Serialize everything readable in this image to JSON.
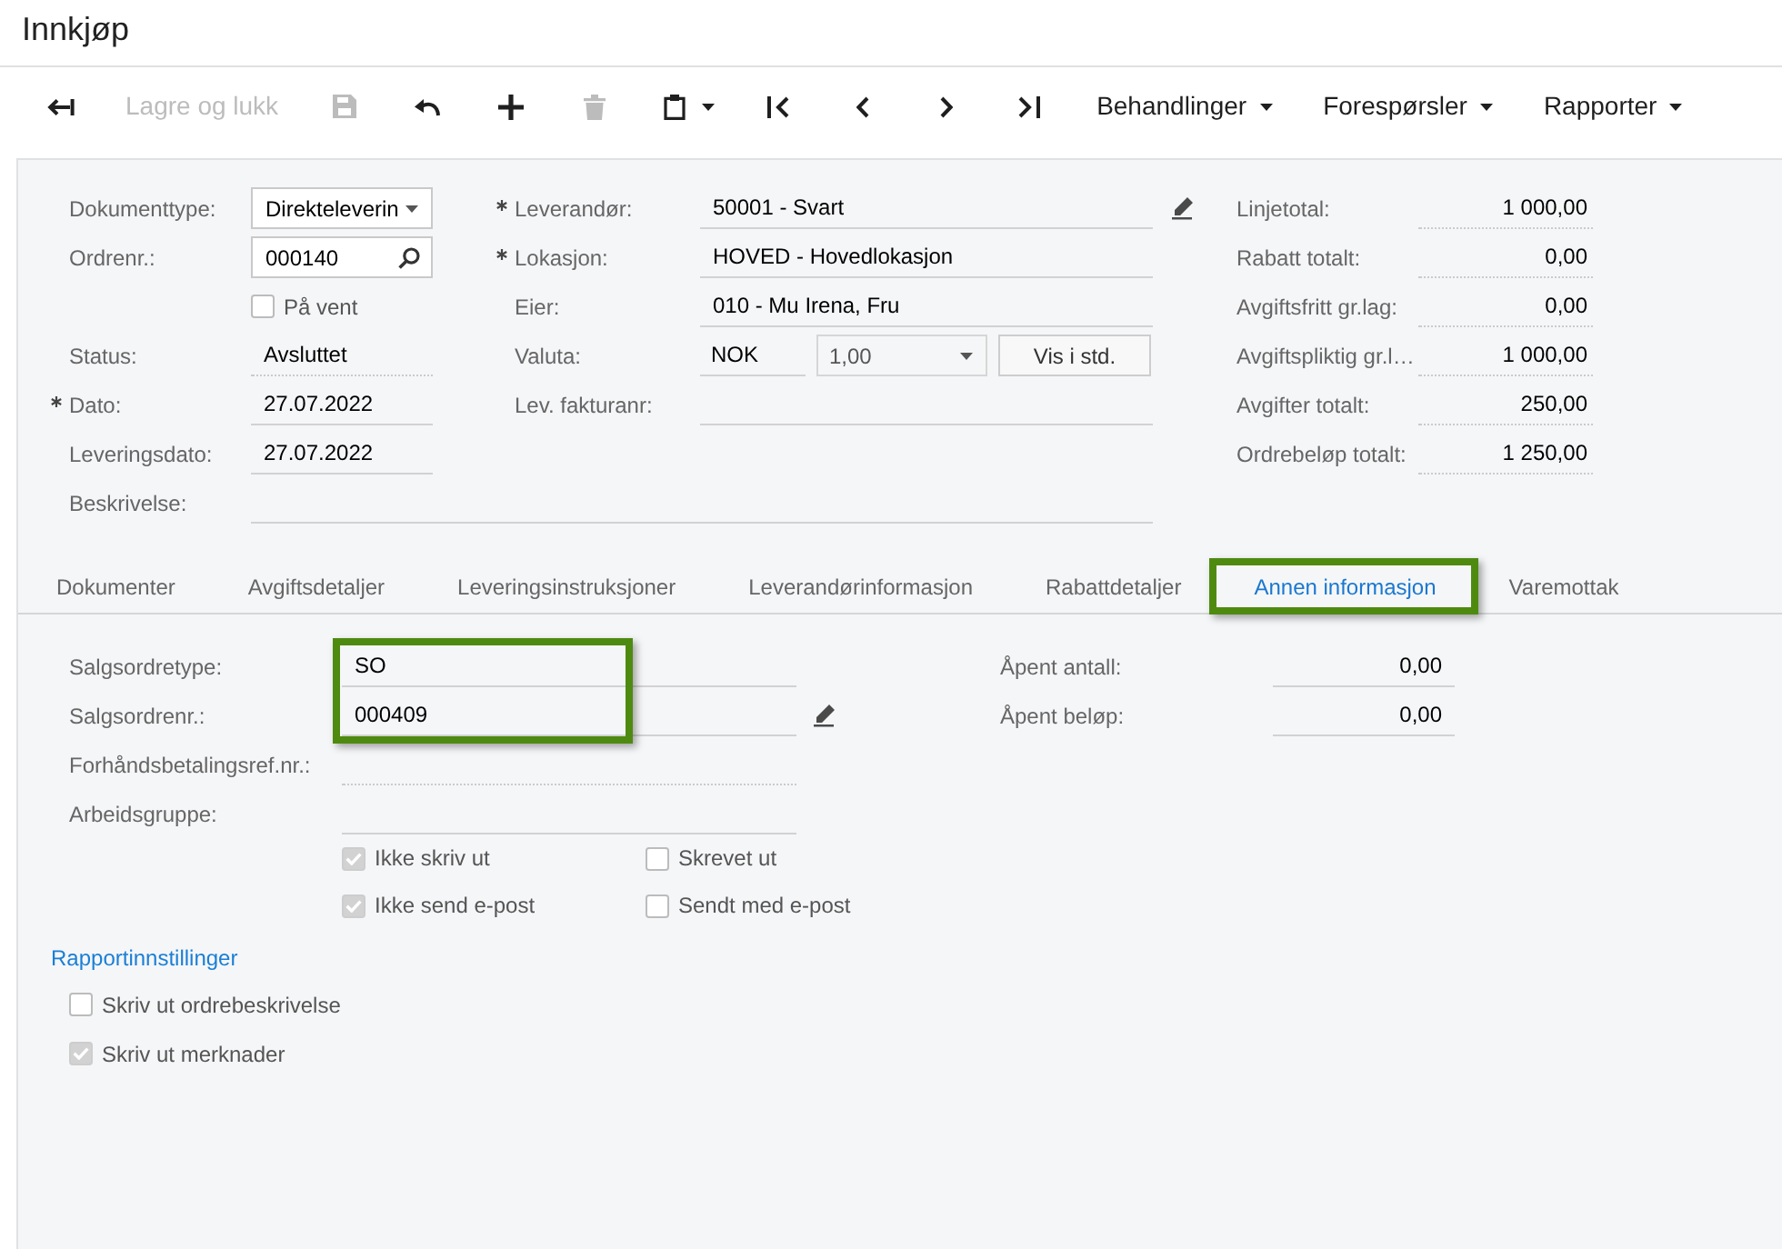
{
  "page_title": "Innkjøp",
  "toolbar": [
    {
      "kind": "back",
      "disabled": false,
      "dropdown": false
    },
    {
      "kind": "save_close",
      "label": "Lagre og lukk",
      "disabled": true,
      "dropdown": false
    },
    {
      "kind": "save",
      "disabled": true,
      "dropdown": false
    },
    {
      "kind": "undo",
      "disabled": false,
      "dropdown": false
    },
    {
      "kind": "add",
      "disabled": false,
      "dropdown": false
    },
    {
      "kind": "delete",
      "disabled": true,
      "dropdown": false
    },
    {
      "kind": "paste",
      "disabled": false,
      "dropdown": true
    },
    {
      "kind": "first",
      "disabled": false,
      "dropdown": false
    },
    {
      "kind": "previous",
      "disabled": false,
      "dropdown": false
    },
    {
      "kind": "next",
      "disabled": false,
      "dropdown": false
    },
    {
      "kind": "last",
      "disabled": false,
      "dropdown": false
    },
    {
      "kind": "menu",
      "label": "Behandlinger",
      "disabled": false,
      "dropdown": true
    },
    {
      "kind": "menu",
      "label": "Forespørsler",
      "disabled": false,
      "dropdown": true
    },
    {
      "kind": "menu",
      "label": "Rapporter",
      "disabled": false,
      "dropdown": true
    }
  ],
  "summary": {
    "left": [
      {
        "kind": "select",
        "label": "Dokumenttype:",
        "value": "Direkteleverin",
        "required": false
      },
      {
        "kind": "lookup",
        "label": "Ordrenr.:",
        "value": "000140",
        "required": false
      },
      {
        "kind": "checkbox",
        "label": "På vent",
        "checked": false,
        "required": false
      },
      {
        "kind": "readonly",
        "label": "Status:",
        "value": "Avsluttet",
        "required": false
      },
      {
        "kind": "input",
        "label": "Dato:",
        "value": "27.07.2022",
        "required": true
      },
      {
        "kind": "input",
        "label": "Leveringsdato:",
        "value": "27.07.2022",
        "required": false
      },
      {
        "kind": "wide_input",
        "label": "Beskrivelse:",
        "required": false
      }
    ],
    "middle": [
      {
        "kind": "input",
        "label": "Leverandør:",
        "value": "50001 - Svart",
        "required": true,
        "editable": true
      },
      {
        "kind": "input",
        "label": "Lokasjon:",
        "value": "HOVED - Hovedlokasjon",
        "required": true,
        "editable": false
      },
      {
        "kind": "input",
        "label": "Eier:",
        "value": "010 - Mu Irena, Fru",
        "required": false,
        "editable": false
      },
      {
        "kind": "currency",
        "label": "Valuta:",
        "value": "NOK",
        "rate": "1,00",
        "button": "Vis i std.",
        "required": false,
        "editable": false
      },
      {
        "kind": "input",
        "label": "Lev. fakturanr:",
        "required": false,
        "editable": false
      }
    ],
    "totals": [
      {
        "label": "Linjetotal:",
        "value": "1 000,00"
      },
      {
        "label": "Rabatt totalt:",
        "value": "0,00"
      },
      {
        "label": "Avgiftsfritt gr.lag:",
        "value": "0,00"
      },
      {
        "label": "Avgiftspliktig gr.l…",
        "value": "1 000,00"
      },
      {
        "label": "Avgifter totalt:",
        "value": "250,00"
      },
      {
        "label": "Ordrebeløp totalt:",
        "value": "1 250,00"
      }
    ]
  },
  "tabs": [
    {
      "label": "Dokumenter",
      "selected": false,
      "highlighted": false
    },
    {
      "label": "Avgiftsdetaljer",
      "selected": false,
      "highlighted": false
    },
    {
      "label": "Leveringsinstruksjoner",
      "selected": false,
      "highlighted": false
    },
    {
      "label": "Leverandørinformasjon",
      "selected": false,
      "highlighted": false
    },
    {
      "label": "Rabattdetaljer",
      "selected": false,
      "highlighted": false
    },
    {
      "label": "Annen informasjon",
      "selected": true,
      "highlighted": true
    },
    {
      "label": "Varemottak",
      "selected": false,
      "highlighted": false
    }
  ],
  "other_info": {
    "fields": [
      {
        "kind": "input",
        "label": "Salgsordretype:",
        "value": "SO",
        "highlighted": true,
        "editable": false
      },
      {
        "kind": "input",
        "label": "Salgsordrenr.:",
        "value": "000409",
        "highlighted": true,
        "editable": true
      },
      {
        "kind": "readonly",
        "label": "Forhåndsbetalingsref.nr.:",
        "highlighted": false,
        "editable": false
      },
      {
        "kind": "input",
        "label": "Arbeidsgruppe:",
        "highlighted": false,
        "editable": false
      }
    ],
    "open_totals": [
      {
        "label": "Åpent antall:",
        "value": "0,00"
      },
      {
        "label": "Åpent beløp:",
        "value": "0,00"
      }
    ],
    "flags": [
      {
        "label": "Ikke skriv ut",
        "checked": true
      },
      {
        "label": "Skrevet ut",
        "checked": false
      },
      {
        "label": "Ikke send e-post",
        "checked": true
      },
      {
        "label": "Sendt med e-post",
        "checked": false
      }
    ],
    "report_settings": {
      "title": "Rapportinnstillinger",
      "options": [
        {
          "label": "Skriv ut ordrebeskrivelse",
          "checked": false
        },
        {
          "label": "Skriv ut merknader",
          "checked": true
        }
      ]
    }
  }
}
